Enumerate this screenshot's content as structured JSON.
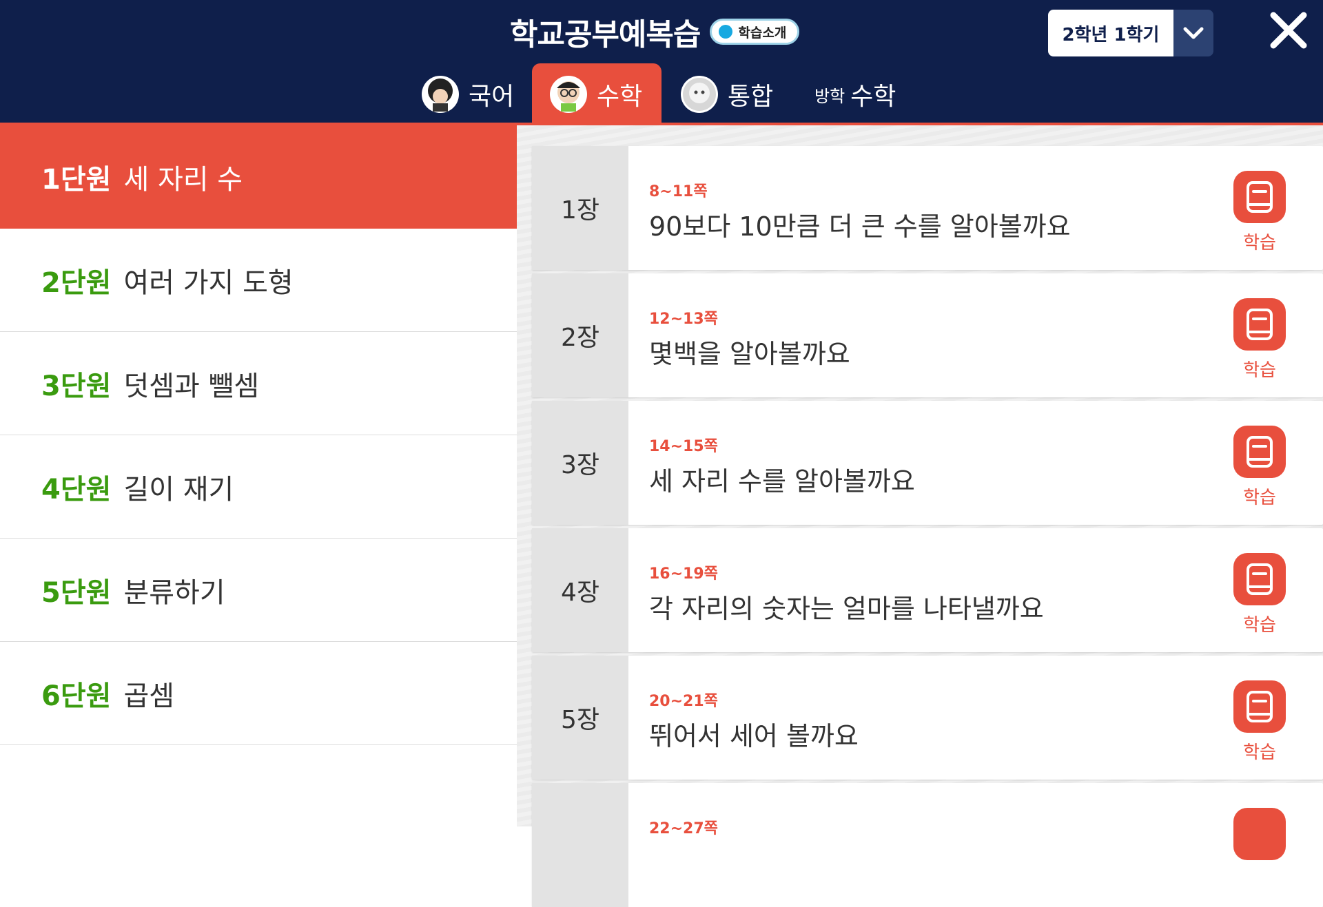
{
  "header": {
    "title": "학교공부예복습",
    "intro_label": "학습소개",
    "grade": "2학년 1학기"
  },
  "tabs": [
    {
      "label": "국어",
      "active": false
    },
    {
      "label": "수학",
      "active": true
    },
    {
      "label": "통합",
      "active": false
    },
    {
      "label": "수학",
      "prefix": "방학",
      "active": false
    }
  ],
  "units": [
    {
      "num": "1단원",
      "name": "세 자리 수",
      "active": true
    },
    {
      "num": "2단원",
      "name": "여러 가지 도형",
      "active": false
    },
    {
      "num": "3단원",
      "name": "덧셈과 뺄셈",
      "active": false
    },
    {
      "num": "4단원",
      "name": "길이 재기",
      "active": false
    },
    {
      "num": "5단원",
      "name": "분류하기",
      "active": false
    },
    {
      "num": "6단원",
      "name": "곱셈",
      "active": false
    }
  ],
  "lessons": [
    {
      "chapter": "1장",
      "pages": "8~11쪽",
      "title": "90보다 10만큼 더 큰 수를 알아볼까요",
      "button": "학습"
    },
    {
      "chapter": "2장",
      "pages": "12~13쪽",
      "title": "몇백을 알아볼까요",
      "button": "학습"
    },
    {
      "chapter": "3장",
      "pages": "14~15쪽",
      "title": "세 자리 수를 알아볼까요",
      "button": "학습"
    },
    {
      "chapter": "4장",
      "pages": "16~19쪽",
      "title": "각 자리의 숫자는 얼마를 나타낼까요",
      "button": "학습"
    },
    {
      "chapter": "5장",
      "pages": "20~21쪽",
      "title": "뛰어서 세어 볼까요",
      "button": "학습"
    },
    {
      "chapter": "",
      "pages": "22~27쪽",
      "title": "",
      "button": ""
    }
  ],
  "colors": {
    "header_bg": "#0f1f4b",
    "accent": "#e84f3d",
    "unit_number": "#3a9b0f"
  },
  "icons": {
    "close": "close-icon",
    "dropdown": "chevron-down-icon",
    "study": "book-icon"
  }
}
